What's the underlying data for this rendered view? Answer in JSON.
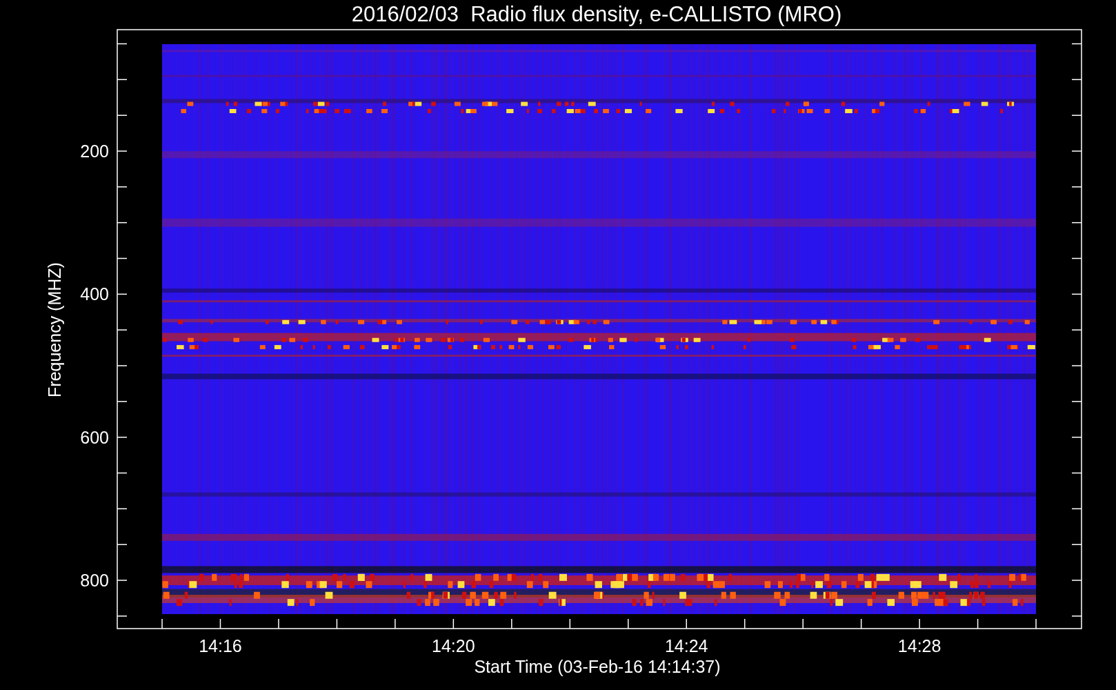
{
  "title": "2016/02/03  Radio flux density, e-CALLISTO (MRO)",
  "y_axis": {
    "label": "Frequency (MHZ)",
    "ticks": [
      "200",
      "400",
      "600",
      "800"
    ]
  },
  "x_axis": {
    "label": "Start Time (03-Feb-16 14:14:37)",
    "ticks": [
      "14:16",
      "14:20",
      "14:24",
      "14:28"
    ]
  }
}
